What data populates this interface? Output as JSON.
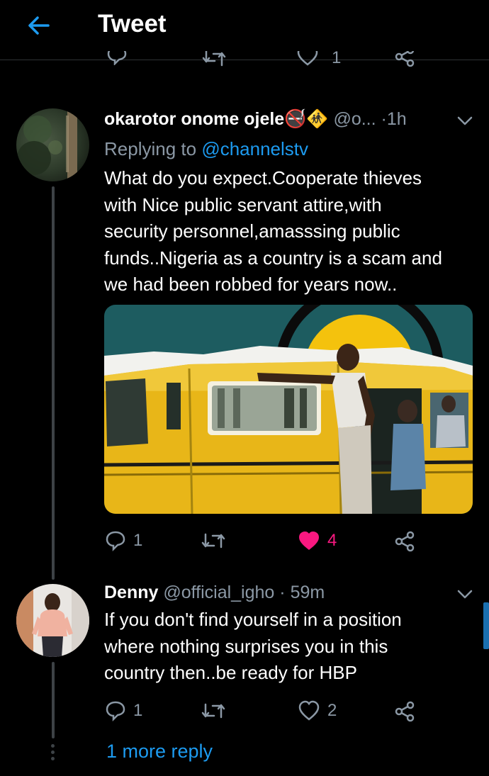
{
  "header": {
    "title": "Tweet"
  },
  "previous_tweet": {
    "like_count": "1"
  },
  "tweet": {
    "name": "okarotor onome ojele",
    "emoji": [
      "🚭",
      "🚸"
    ],
    "handle": "@o...",
    "separator": "·",
    "time": "1h",
    "replying_label": "Replying to",
    "replying_to": "@channelstv",
    "text": "What do you expect.Cooperate thieves with Nice public servant attire,with security personnel,amasssing public funds..Nigeria as a country is a scam and we had been robbed for years now..",
    "text_lines": [
      "What do you expect.Cooperate thieves",
      "with Nice public servant attire,with",
      "security personnel,amasssing public",
      "funds..Nigeria as a country is a scam and",
      "we had been robbed for years now.."
    ],
    "reply_count": "1",
    "retweet_count": "",
    "like_count": "4",
    "liked": true
  },
  "reply": {
    "name": "Denny",
    "handle": "@official_igho",
    "separator": "·",
    "time": "59m",
    "text": "If you don't find yourself in a position where nothing surprises you in this country then..be ready for HBP",
    "text_lines": [
      "If you don't find yourself in a position",
      "where nothing surprises you in this",
      "country then..be ready for HBP"
    ],
    "reply_count": "1",
    "retweet_count": "",
    "like_count": "2",
    "liked": false
  },
  "more_replies_label": "1 more reply",
  "colors": {
    "accent": "#1d9bf0",
    "like": "#f91880",
    "muted": "#8b98a5",
    "background": "#000000"
  }
}
